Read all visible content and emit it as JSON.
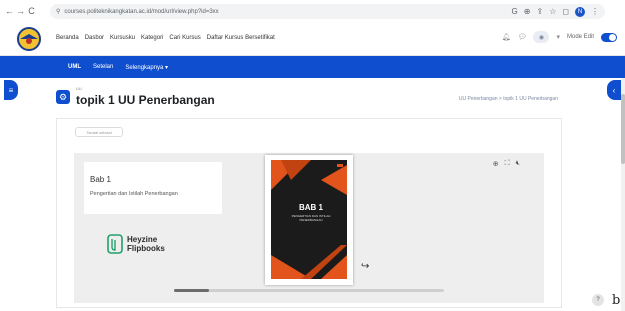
{
  "browser": {
    "url": "courses.politeknikangkatan.ac.id/mod/url/view.php?id=3xx",
    "avatar_letter": "N"
  },
  "site_nav": {
    "links": [
      "Beranda",
      "Dasbor",
      "Kursusku",
      "Kategori",
      "Cari Kursus",
      "Daftar Kursus Bersetifikat"
    ],
    "mode_edit_label": "Mode Edit"
  },
  "course_nav": {
    "items": [
      "UML",
      "Setelan",
      "Selengkapnya"
    ]
  },
  "header": {
    "course_short": "UU",
    "title": "topik 1 UU Penerbangan",
    "breadcrumb": "UU Penerbangan > topik 1 UU Penerbangan"
  },
  "activity": {
    "done_button": "Tandai selesai"
  },
  "flipbook": {
    "chapter_title": "Bab 1",
    "chapter_subtitle": "Pengertian dan Istilah Penerbangan",
    "brand_line1": "Heyzine",
    "brand_line2": "Flipbooks",
    "cover_title": "BAB 1",
    "cover_subtitle": "PENGERTIAN DAN ISTILAH PENERBANGAN",
    "scroll_progress": 0.13
  },
  "help": {
    "label": "?"
  },
  "trailing_text": "b",
  "colors": {
    "accent": "#0f4fcf",
    "cover_orange": "#e2541b"
  }
}
